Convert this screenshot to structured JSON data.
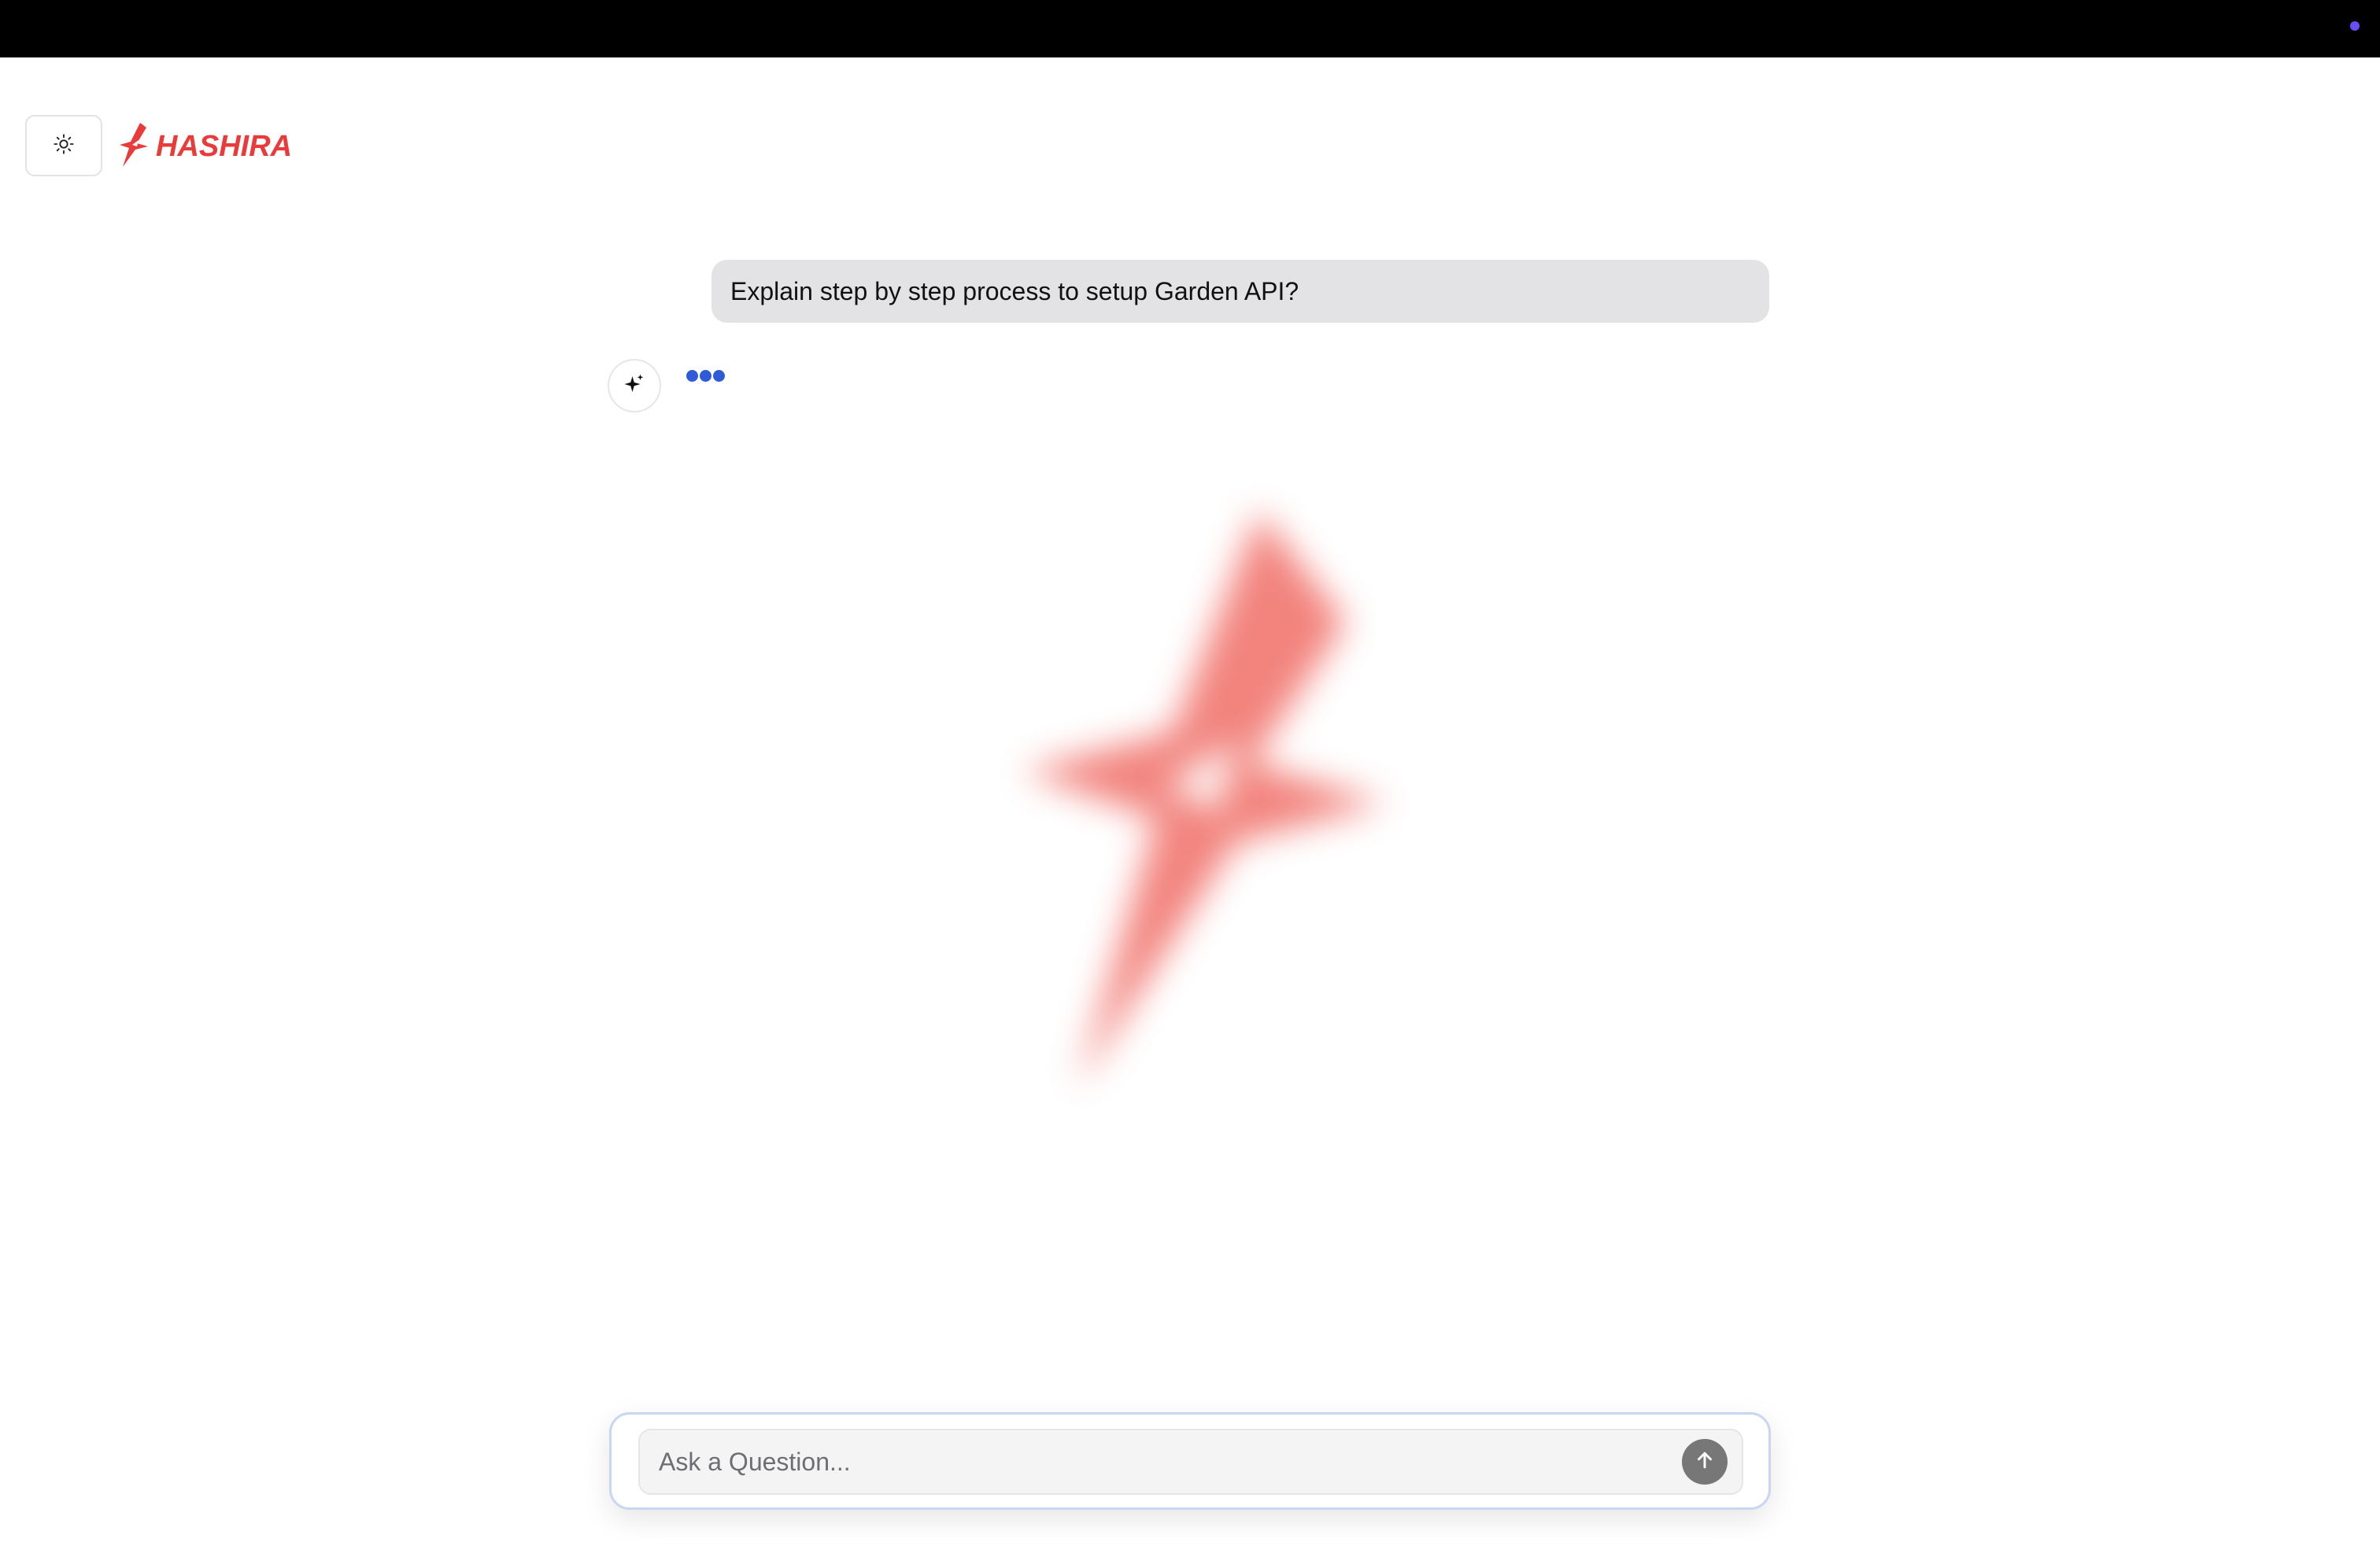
{
  "header": {
    "theme_toggle_icon": "sun-icon",
    "logo_text": "HASHIRA",
    "brand_color": "#ea3b3b"
  },
  "conversation": {
    "user_message": "Explain step by step process to setup Garden API?",
    "assistant_avatar_icon": "sparkle-icon",
    "assistant_state": "typing",
    "typing_dot_color": "#2f5bd8"
  },
  "composer": {
    "placeholder": "Ask a Question...",
    "send_icon": "arrow-up-icon"
  }
}
